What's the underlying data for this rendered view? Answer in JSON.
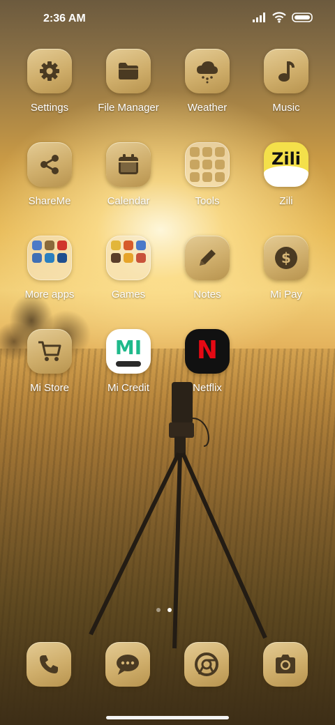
{
  "status_bar": {
    "time": "2:36 AM",
    "icons": [
      "signal-icon",
      "wifi-icon",
      "battery-icon"
    ]
  },
  "apps": [
    {
      "label": "Settings",
      "icon": "gear-icon"
    },
    {
      "label": "File Manager",
      "icon": "folder-icon"
    },
    {
      "label": "Weather",
      "icon": "cloud-rain-icon"
    },
    {
      "label": "Music",
      "icon": "music-note-icon"
    },
    {
      "label": "ShareMe",
      "icon": "share-icon"
    },
    {
      "label": "Calendar",
      "icon": "calendar-icon"
    },
    {
      "label": "Tools",
      "icon": "folder"
    },
    {
      "label": "Zili",
      "icon": "zili-logo",
      "logo_text": "Zili"
    },
    {
      "label": "More apps",
      "icon": "folder"
    },
    {
      "label": "Games",
      "icon": "folder"
    },
    {
      "label": "Notes",
      "icon": "pencil-icon"
    },
    {
      "label": "Mi Pay",
      "icon": "dollar-coin-icon"
    },
    {
      "label": "Mi Store",
      "icon": "cart-icon"
    },
    {
      "label": "Mi Credit",
      "icon": "mi-credit-logo",
      "logo_text": "MI"
    },
    {
      "label": "Netflix",
      "icon": "netflix-logo",
      "logo_text": "N"
    }
  ],
  "page_indicator": {
    "pages": 2,
    "current": 2
  },
  "dock": [
    {
      "name": "phone",
      "icon": "phone-icon"
    },
    {
      "name": "messages",
      "icon": "message-icon"
    },
    {
      "name": "browser",
      "icon": "chrome-icon"
    },
    {
      "name": "camera",
      "icon": "camera-icon"
    }
  ],
  "colors": {
    "icon_tile": "#d6b676",
    "glyph": "#4a3a22",
    "netflix_red": "#e50914",
    "mi_credit_green": "#1fb98b",
    "zili_yellow": "#f7e11b"
  }
}
